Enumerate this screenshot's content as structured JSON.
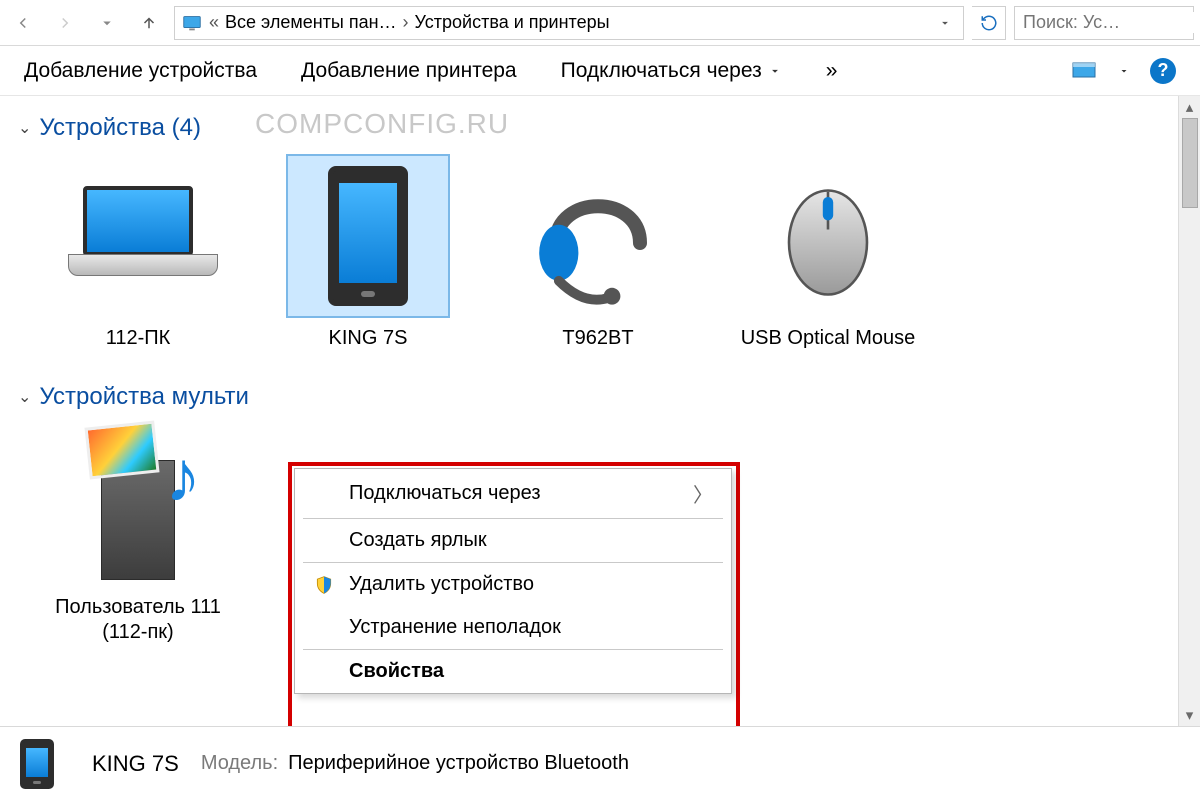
{
  "breadcrumb": {
    "up_tooltip": "Вверх",
    "root_label": "Все элементы пан…",
    "current_label": "Устройства и принтеры"
  },
  "search": {
    "placeholder": "Поиск: Ус…"
  },
  "toolbar": {
    "add_device": "Добавление устройства",
    "add_printer": "Добавление принтера",
    "connect_via": "Подключаться через",
    "overflow": "»"
  },
  "groups": {
    "devices_header": "Устройства (4)",
    "multimedia_header": "Устройства мульти"
  },
  "watermark": "COMPCONFIG.RU",
  "devices": [
    {
      "name": "112-ПК",
      "kind": "laptop"
    },
    {
      "name": "KING 7S",
      "kind": "phone",
      "selected": true
    },
    {
      "name": "T962BT",
      "kind": "headset"
    },
    {
      "name": "USB Optical Mouse",
      "kind": "mouse"
    }
  ],
  "multimedia": [
    {
      "name": "Пользователь 111 (112-пк)",
      "kind": "media-server"
    }
  ],
  "context_menu": {
    "connect_via": "Подключаться через",
    "create_shortcut": "Создать ярлык",
    "remove_device": "Удалить устройство",
    "troubleshoot": "Устранение неполадок",
    "properties": "Свойства"
  },
  "details": {
    "name": "KING 7S",
    "model_label": "Модель:",
    "model_value": "Периферийное устройство Bluetooth"
  }
}
